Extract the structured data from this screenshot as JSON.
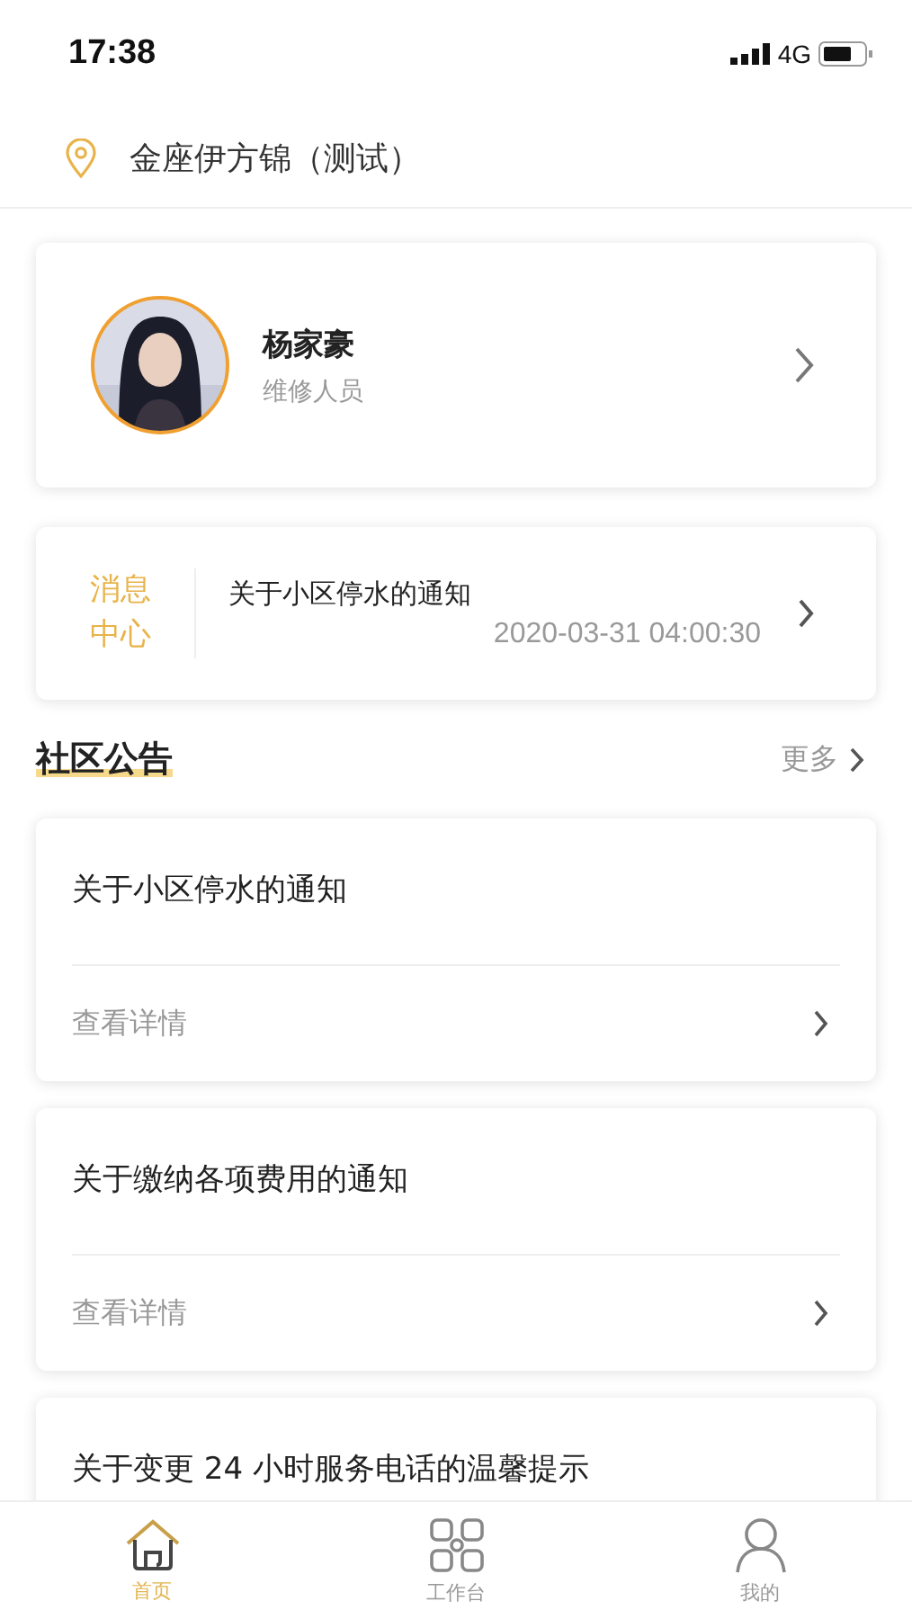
{
  "status_bar": {
    "time": "17:38",
    "network": "4G"
  },
  "location": {
    "name": "金座伊方锦（测试）"
  },
  "profile": {
    "name": "杨家豪",
    "role": "维修人员"
  },
  "message_center": {
    "label_line1": "消息",
    "label_line2": "中心",
    "title": "关于小区停水的通知",
    "time": "2020-03-31 04:00:30"
  },
  "section": {
    "title": "社区公告",
    "more": "更多"
  },
  "notices": [
    {
      "title": "关于小区停水的通知",
      "detail": "查看详情"
    },
    {
      "title": "关于缴纳各项费用的通知",
      "detail": "查看详情"
    },
    {
      "title": "关于变更 24 小时服务电话的温馨提示"
    }
  ],
  "tab_bar": [
    {
      "label": "首页",
      "kind": "home",
      "selected": true
    },
    {
      "label": "工作台",
      "kind": "grid",
      "selected": false
    },
    {
      "label": "我的",
      "kind": "person",
      "selected": false
    }
  ]
}
